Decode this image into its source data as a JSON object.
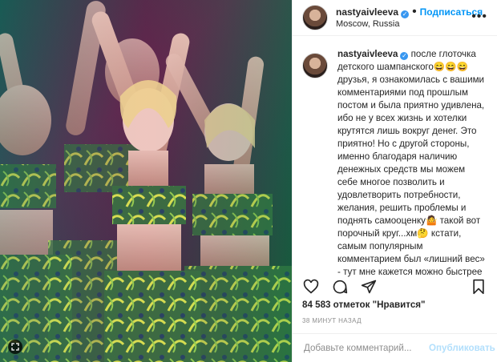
{
  "post": {
    "username": "nastyaivleeva",
    "location": "Moscow, Russia",
    "follow_label": "Подписаться",
    "dot": "•",
    "caption_username": "nastyaivleeva",
    "caption_text": "после глоточка детского шампанского😄😄😄 друзья, я ознакомилась с вашими комментариями под прошлым постом и была приятно удивлена, ибо не у всех жизнь и хотелки крутятся лишь вокруг денег. Это приятно! Но с другой стороны, именно благодаря наличию денежных средств мы можем себе многое позволить и удовлетворить потребности, желания, решить проблемы и поднять самооценку🤷 такой вот порочный круг...хм🤔 кстати, самым популярным комментарием был «лишний вес» - тут мне кажется можно быстрее результатов добиться , если очень сильно захотеть, тем самым",
    "likes": "84 583 отметок \"Нравится\"",
    "time": "38 МИНУТ НАЗАД",
    "comment_placeholder": "Добавьте комментарий...",
    "publish_label": "Опубликовать",
    "more_label": "•••"
  },
  "icons": {
    "verified": "verified-badge-icon",
    "like": "heart-icon",
    "comment": "comment-icon",
    "share": "share-icon",
    "save": "bookmark-icon",
    "expand": "expand-icon"
  },
  "colors": {
    "accent": "#0095f6",
    "publish_disabled": "#b2dffc",
    "verified": "#3897f0"
  }
}
